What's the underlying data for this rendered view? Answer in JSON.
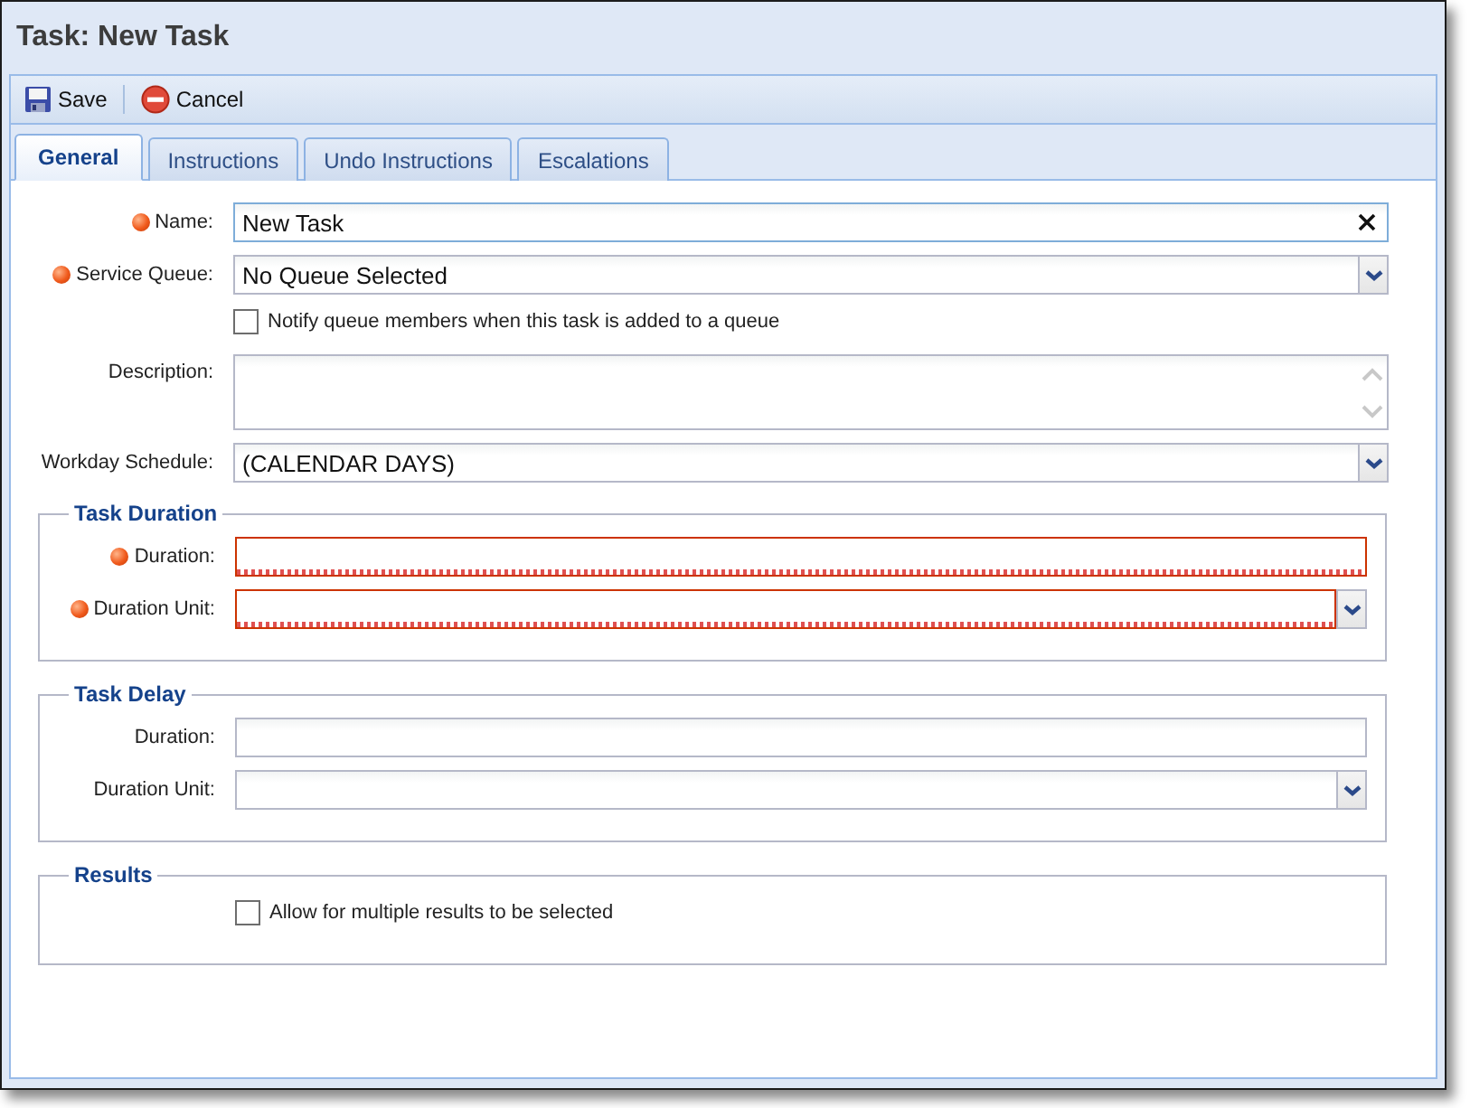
{
  "window": {
    "title": "Task: New Task"
  },
  "toolbar": [
    {
      "label": "Save",
      "kind": "save"
    },
    {
      "label": "Cancel",
      "kind": "cancel"
    }
  ],
  "tabs": [
    {
      "label": "General",
      "selected": true
    },
    {
      "label": "Instructions",
      "selected": false
    },
    {
      "label": "Undo Instructions",
      "selected": false
    },
    {
      "label": "Escalations",
      "selected": false
    }
  ],
  "fields": [
    {
      "kind": "text",
      "label": "Name:",
      "required": true,
      "value": "New Task",
      "clearable": true
    },
    {
      "kind": "combo",
      "label": "Service Queue:",
      "required": true,
      "value": "No Queue Selected"
    },
    {
      "kind": "checkbox",
      "label": "Notify queue members when this task is added to a queue",
      "checked": false
    },
    {
      "kind": "textarea",
      "label": "Description:",
      "required": false
    },
    {
      "kind": "combo",
      "label": "Workday Schedule:",
      "required": false,
      "value": "(CALENDAR DAYS)"
    }
  ],
  "sections": [
    {
      "legend": "Task Duration",
      "fields": [
        {
          "kind": "text",
          "label": "Duration:",
          "required": true,
          "invalid": true
        },
        {
          "kind": "combo",
          "label": "Duration Unit:",
          "required": true,
          "invalid": true
        }
      ]
    },
    {
      "legend": "Task Delay",
      "fields": [
        {
          "kind": "text",
          "label": "Duration:",
          "required": false,
          "invalid": false
        },
        {
          "kind": "combo",
          "label": "Duration Unit:",
          "required": false,
          "invalid": false
        }
      ]
    },
    {
      "legend": "Results",
      "fields": [
        {
          "kind": "checkbox",
          "label": "Allow for multiple results to be selected",
          "checked": false
        }
      ]
    }
  ]
}
